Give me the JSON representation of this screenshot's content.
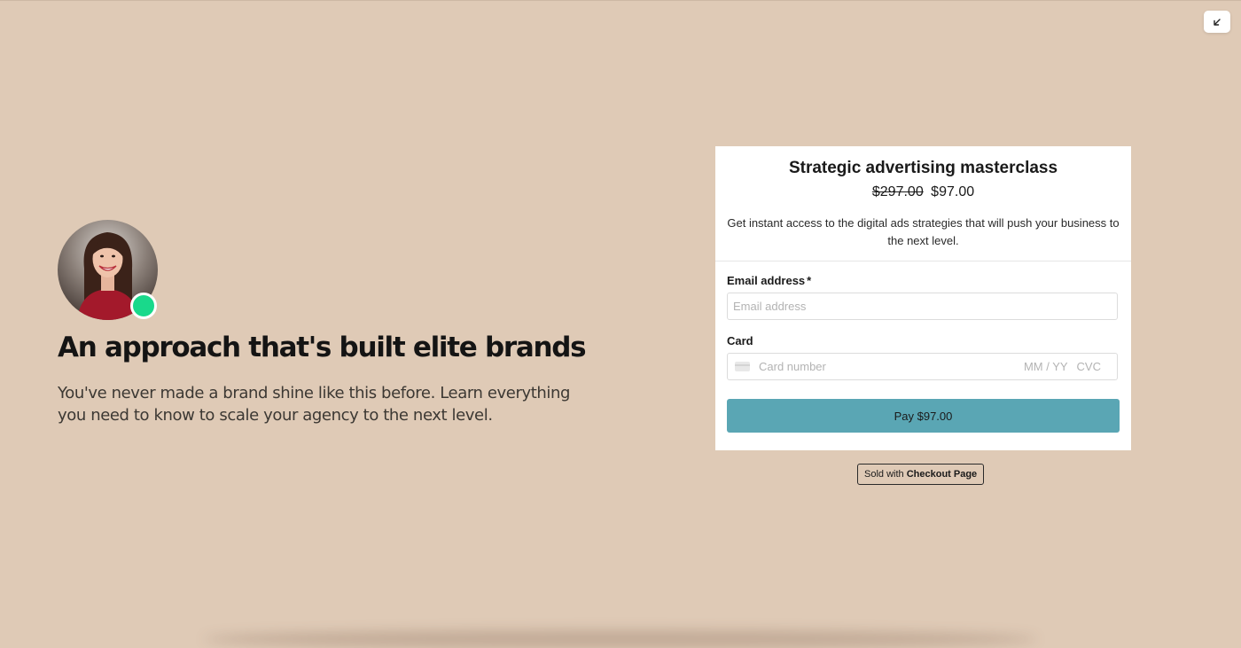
{
  "hero": {
    "headline": "An approach that's built elite brands",
    "subline": "You've never made a brand shine like this before. Learn everything you need to know to scale your agency to the next level.",
    "avatar_icon": "person-photo",
    "status_color": "#19d98b"
  },
  "checkout": {
    "product_title": "Strategic advertising masterclass",
    "price_original": "$297.00",
    "price_current": "$97.00",
    "description": "Get instant access to the digital ads strategies that will push your business to the next level.",
    "email_label": "Email address",
    "required_mark": "*",
    "email_placeholder": "Email address",
    "card_label": "Card",
    "card_number_placeholder": "Card number",
    "card_expiry_placeholder": "MM / YY",
    "card_cvc_placeholder": "CVC",
    "pay_button": "Pay $97.00",
    "pay_button_color": "#5aa6b4"
  },
  "footer": {
    "sold_with": "Sold with",
    "brand": "Checkout Page"
  },
  "colors": {
    "background": "#dfcab6"
  },
  "controls": {
    "collapse_icon": "arrow-down-left"
  }
}
